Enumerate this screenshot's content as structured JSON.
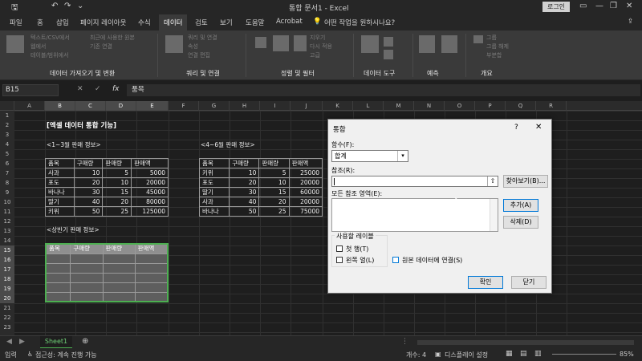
{
  "titlebar": {
    "doc_title": "통합 문서1 - Excel",
    "login": "로그인",
    "qa_save": "🖫",
    "qa_undo": "↶",
    "qa_redo": "↷",
    "qa_more": "⌄",
    "win_restore": "▭",
    "win_min": "—",
    "win_max": "❐",
    "win_close": "✕"
  },
  "tabs": [
    {
      "label": "파일"
    },
    {
      "label": "홈"
    },
    {
      "label": "삽입"
    },
    {
      "label": "페이지 레이아웃"
    },
    {
      "label": "수식"
    },
    {
      "label": "데이터"
    },
    {
      "label": "검토"
    },
    {
      "label": "보기"
    },
    {
      "label": "도움말"
    },
    {
      "label": "Acrobat"
    }
  ],
  "tellme": "어떤 작업을 원하시나요?",
  "share_icon": "⇪",
  "ribbon": {
    "groups": [
      "데이터 가져오기 및 변환",
      "쿼리 및 연결",
      "정렬 및 필터",
      "데이터 도구",
      "예측",
      "개요"
    ],
    "grey_items": [
      "텍스트/CSV에서",
      "웹에서",
      "테이블/범위에서",
      "최근에 사용한 원본",
      "기존 연결",
      "쿼리 및 연결",
      "속성",
      "연결 편집",
      "지우기",
      "다시 적용",
      "고급",
      "그룹",
      "그룹 해제",
      "부분합"
    ]
  },
  "formula_bar": {
    "namebox": "B15",
    "value": "품목",
    "cancel_icon": "✕",
    "enter_icon": "✓",
    "fx": "fx"
  },
  "columns": [
    "A",
    "B",
    "C",
    "D",
    "E",
    "F",
    "G",
    "H",
    "I",
    "J",
    "K",
    "L",
    "M",
    "N",
    "O",
    "P",
    "Q",
    "R"
  ],
  "rows": [
    "1",
    "2",
    "3",
    "4",
    "5",
    "6",
    "7",
    "8",
    "9",
    "10",
    "11",
    "12",
    "13",
    "14",
    "15",
    "16",
    "17",
    "18",
    "19",
    "20",
    "21",
    "22",
    "23"
  ],
  "sheet": {
    "heading": "[엑셀 데이터 통합 기능]",
    "q1_label": "<1~3월 판매 정보>",
    "q2_label": "<4~6월 판매 정보>",
    "h1_label": "<상반기 판매 정보>",
    "headers": [
      "품목",
      "구매량",
      "판매량",
      "판매액"
    ],
    "table1": [
      [
        "사과",
        "10",
        "5",
        "5000"
      ],
      [
        "포도",
        "20",
        "10",
        "20000"
      ],
      [
        "바나나",
        "30",
        "15",
        "45000"
      ],
      [
        "딸기",
        "40",
        "20",
        "80000"
      ],
      [
        "키위",
        "50",
        "25",
        "125000"
      ]
    ],
    "table2": [
      [
        "키위",
        "10",
        "5",
        "25000"
      ],
      [
        "포도",
        "20",
        "10",
        "20000"
      ],
      [
        "딸기",
        "30",
        "15",
        "60000"
      ],
      [
        "사과",
        "40",
        "20",
        "20000"
      ],
      [
        "바나나",
        "50",
        "25",
        "75000"
      ]
    ]
  },
  "sheet_tab": "Sheet1",
  "status": {
    "ready": "입력",
    "accessibility": "접근성: 계속 진행 가능",
    "count": "개수: 4",
    "display": "디스플레이 설정",
    "zoom": "85%"
  },
  "dialog": {
    "title": "통합",
    "help": "?",
    "close": "✕",
    "function_label": "함수(F):",
    "function_value": "합계",
    "reference_label": "참조(R):",
    "browse": "찾아보기(B)...",
    "all_refs_label": "모든 참조 영역(E):",
    "add": "추가(A)",
    "delete": "삭제(D)",
    "labels_group": "사용할 레이블",
    "top_row": "첫 행(T)",
    "left_col": "왼쪽 열(L)",
    "link": "원본 데이터에 연결(S)",
    "ok": "확인",
    "cancel": "닫기"
  },
  "colors": {
    "accent_green": "#4caf50",
    "selection": "#8f8f8f",
    "dialog_bg": "#f0f0f0"
  }
}
